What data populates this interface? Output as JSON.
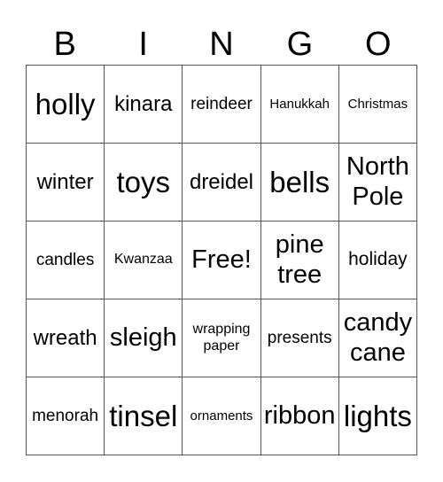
{
  "header": [
    "B",
    "I",
    "N",
    "G",
    "O"
  ],
  "cells": [
    [
      {
        "text": "holly",
        "size": "s-xl"
      },
      {
        "text": "kinara",
        "size": "s-m"
      },
      {
        "text": "reindeer",
        "size": "s-sm"
      },
      {
        "text": "Hanukkah",
        "size": "s-xs"
      },
      {
        "text": "Christmas",
        "size": "s-xs"
      }
    ],
    [
      {
        "text": "winter",
        "size": "s-m"
      },
      {
        "text": "toys",
        "size": "s-xl"
      },
      {
        "text": "dreidel",
        "size": "s-m"
      },
      {
        "text": "bells",
        "size": "s-xl"
      },
      {
        "text": "North Pole",
        "size": "s-l"
      }
    ],
    [
      {
        "text": "candles",
        "size": "s-sm"
      },
      {
        "text": "Kwanzaa",
        "size": "s-s"
      },
      {
        "text": "Free!",
        "size": "s-l"
      },
      {
        "text": "pine tree",
        "size": "s-l"
      },
      {
        "text": "holiday",
        "size": "s-n"
      }
    ],
    [
      {
        "text": "wreath",
        "size": "s-m"
      },
      {
        "text": "sleigh",
        "size": "s-l"
      },
      {
        "text": "wrapping paper",
        "size": "s-s"
      },
      {
        "text": "presents",
        "size": "s-sm"
      },
      {
        "text": "candy cane",
        "size": "s-l"
      }
    ],
    [
      {
        "text": "menorah",
        "size": "s-sm"
      },
      {
        "text": "tinsel",
        "size": "s-xl"
      },
      {
        "text": "ornaments",
        "size": "s-xs"
      },
      {
        "text": "ribbon",
        "size": "s-l"
      },
      {
        "text": "lights",
        "size": "s-xl"
      }
    ]
  ]
}
